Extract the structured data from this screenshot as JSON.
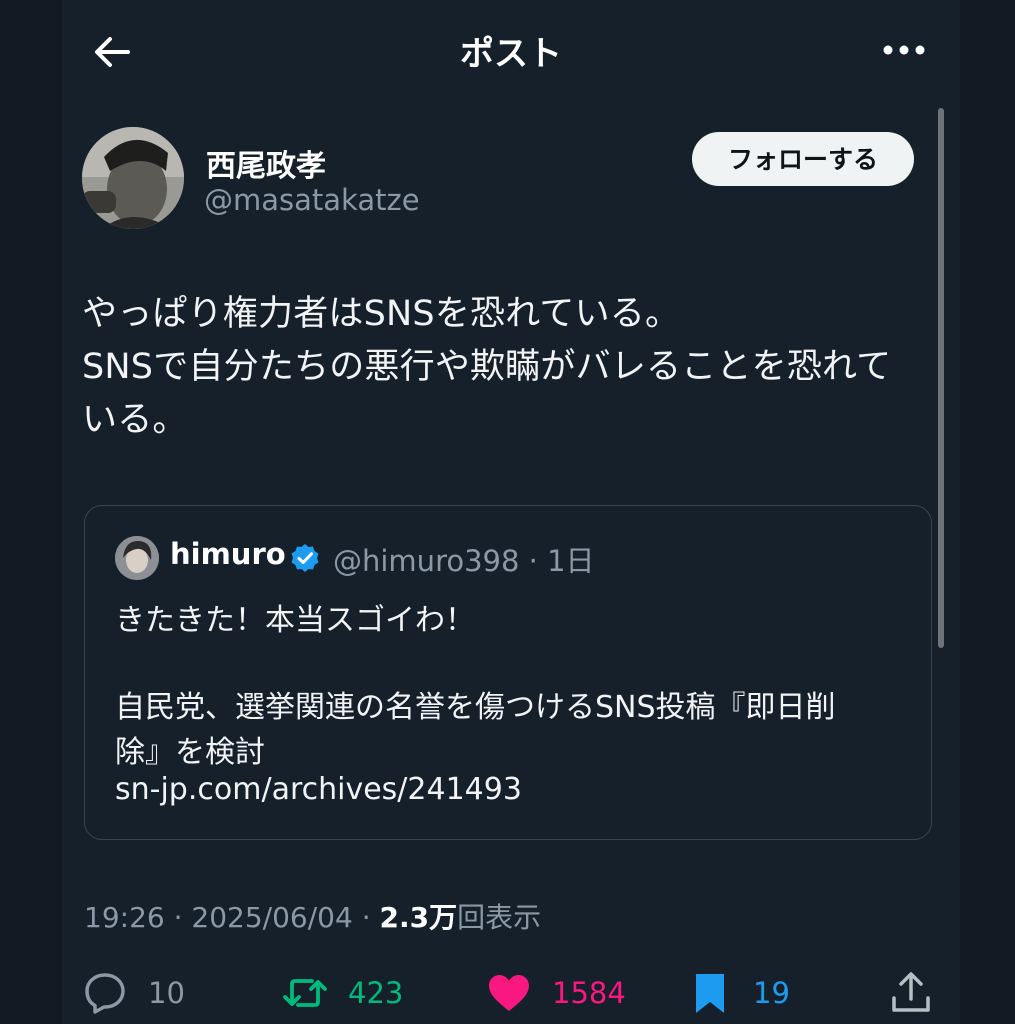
{
  "header": {
    "title": "ポスト"
  },
  "post": {
    "author_name": "西尾政孝",
    "author_handle": "@masatakatze",
    "follow_label": "フォローする",
    "lines": [
      "やっぱり権力者はSNSを恐れている。",
      "SNSで自分たちの悪行や欺瞞がバレることを恐れて",
      "いる。"
    ],
    "time": "19:26",
    "date": "2025/06/04",
    "views_count": "2.3万",
    "views_label": "回表示",
    "separator": "·"
  },
  "quote": {
    "name": "himuro",
    "handle_time": "@himuro398 · 1日",
    "line1": "きたきた！本当スゴイわ！",
    "line2": "自民党、選挙関連の名誉を傷つけるSNS投稿『即日削",
    "line3": "除』を検討",
    "link": "sn-jp.com/archives/241493"
  },
  "actions": {
    "replies": "10",
    "reposts": "423",
    "likes": "1584",
    "bookmarks": "19"
  },
  "colors": {
    "background": "#15202b",
    "repost": "#00ba7c",
    "like": "#f91880",
    "bookmark": "#1d9bf0",
    "verified": "#1d9bf0"
  },
  "icons": [
    "back-arrow-icon",
    "more-icon",
    "verified-icon",
    "reply-icon",
    "repost-icon",
    "like-icon",
    "bookmark-icon",
    "share-icon"
  ]
}
